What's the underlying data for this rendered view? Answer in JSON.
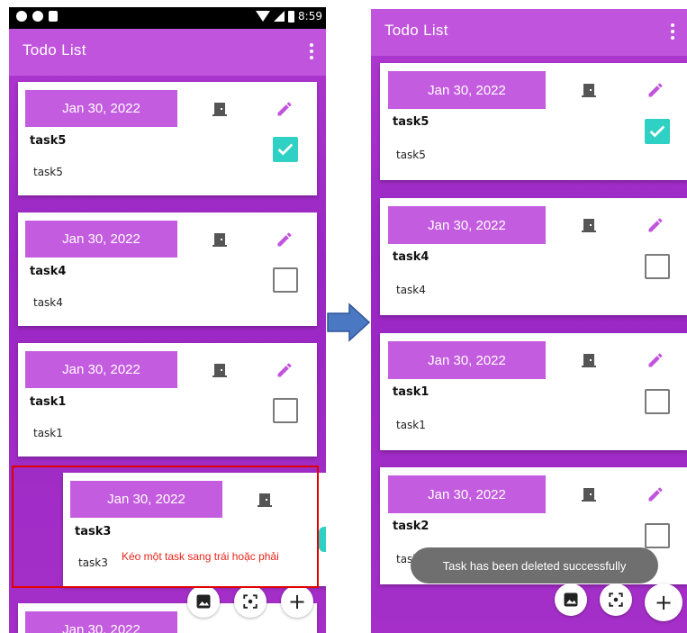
{
  "app": {
    "title": "Todo List"
  },
  "status": {
    "time": "8:59"
  },
  "colors": {
    "accent": "#c154dd",
    "pill": "#c45cdf",
    "checked": "#2ed1c3",
    "note": "#e8231a"
  },
  "left_screen": {
    "cards": [
      {
        "date": "Jan 30, 2022",
        "title": "task5",
        "desc": "task5",
        "checked": true
      },
      {
        "date": "Jan 30, 2022",
        "title": "task4",
        "desc": "task4",
        "checked": false
      },
      {
        "date": "Jan 30, 2022",
        "title": "task1",
        "desc": "task1",
        "checked": false
      },
      {
        "date": "Jan 30, 2022",
        "title": "task3",
        "desc": "task3",
        "checked": false
      },
      {
        "date": "Jan 30, 2022"
      }
    ],
    "swipe_note": "Kéo một task sang trái hoặc phải"
  },
  "right_screen": {
    "cards": [
      {
        "date": "Jan 30, 2022",
        "title": "task5",
        "desc": "task5",
        "checked": true
      },
      {
        "date": "Jan 30, 2022",
        "title": "task4",
        "desc": "task4",
        "checked": false
      },
      {
        "date": "Jan 30, 2022",
        "title": "task1",
        "desc": "task1",
        "checked": false
      },
      {
        "date": "Jan 30, 2022",
        "title": "task2",
        "desc": "task2",
        "checked": false
      }
    ],
    "toast": "Task has been deleted successfully"
  },
  "fab_icons": [
    "image-icon",
    "scan-icon",
    "plus-icon"
  ],
  "fab_plus": "+"
}
